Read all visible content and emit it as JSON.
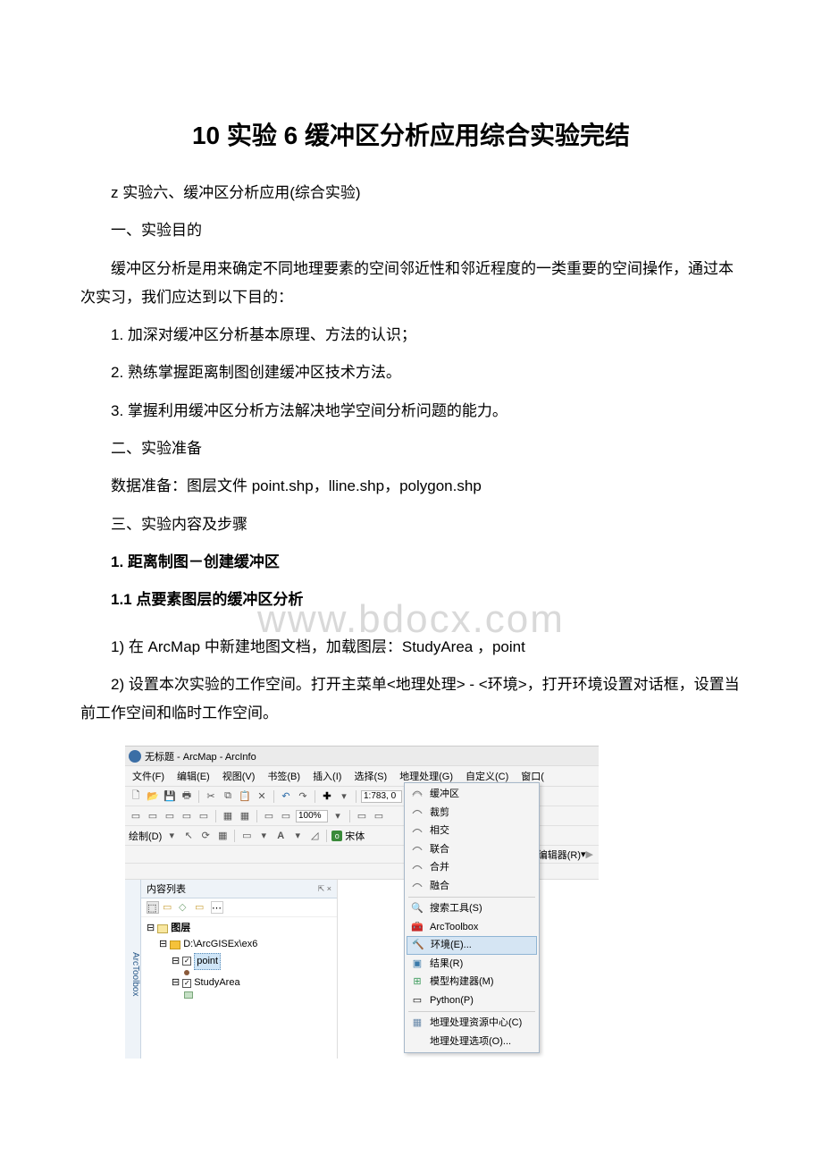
{
  "doc": {
    "title": "10 实验 6 缓冲区分析应用综合实验完结",
    "p1": "z 实验六、缓冲区分析应用(综合实验)",
    "p2": "一、实验目的",
    "p3": "缓冲区分析是用来确定不同地理要素的空间邻近性和邻近程度的一类重要的空间操作，通过本次实习，我们应达到以下目的：",
    "p4": "1. 加深对缓冲区分析基本原理、方法的认识；",
    "p5": "2. 熟练掌握距离制图创建缓冲区技术方法。",
    "p6": "3. 掌握利用缓冲区分析方法解决地学空间分析问题的能力。",
    "p7": "二、实验准备",
    "p8": "数据准备：图层文件 point.shp，lline.shp，polygon.shp",
    "p9": "三、实验内容及步骤",
    "p10": "1. 距离制图－创建缓冲区",
    "p11": "1.1 点要素图层的缓冲区分析",
    "p12": "1) 在 ArcMap 中新建地图文档，加载图层：StudyArea ，point",
    "p13": "2) 设置本次实验的工作空间。打开主菜单<地理处理> - <环境>，打开环境设置对话框，设置当前工作空间和临时工作空间。",
    "watermark": "www.bdocx.com"
  },
  "app": {
    "title": "无标题 - ArcMap - ArcInfo",
    "menus": [
      "文件(F)",
      "编辑(E)",
      "视图(V)",
      "书签(B)",
      "插入(I)",
      "选择(S)",
      "地理处理(G)",
      "自定义(C)",
      "窗口("
    ],
    "scale": "1:783, 0",
    "zoom": "100%",
    "draw_label": "绘制(D)",
    "font_label": "宋体",
    "editor_label": "编辑器(R)",
    "toc_title": "内容列表",
    "toc_pin": "⇱ ×",
    "arctoolbox_tab": "ArcToolbox",
    "tree": {
      "root": "图层",
      "folder": "D:\\ArcGISEx\\ex6",
      "layer1": "point",
      "layer2": "StudyArea"
    },
    "dropdown": {
      "items_top": [
        "缓冲区",
        "裁剪",
        "相交",
        "联合",
        "合并",
        "融合"
      ],
      "search": "搜索工具(S)",
      "arctoolbox": "ArcToolbox",
      "env": "环境(E)...",
      "results": "结果(R)",
      "modelbuilder": "模型构建器(M)",
      "python": "Python(P)",
      "resource": "地理处理资源中心(C)",
      "options": "地理处理选项(O)..."
    }
  }
}
